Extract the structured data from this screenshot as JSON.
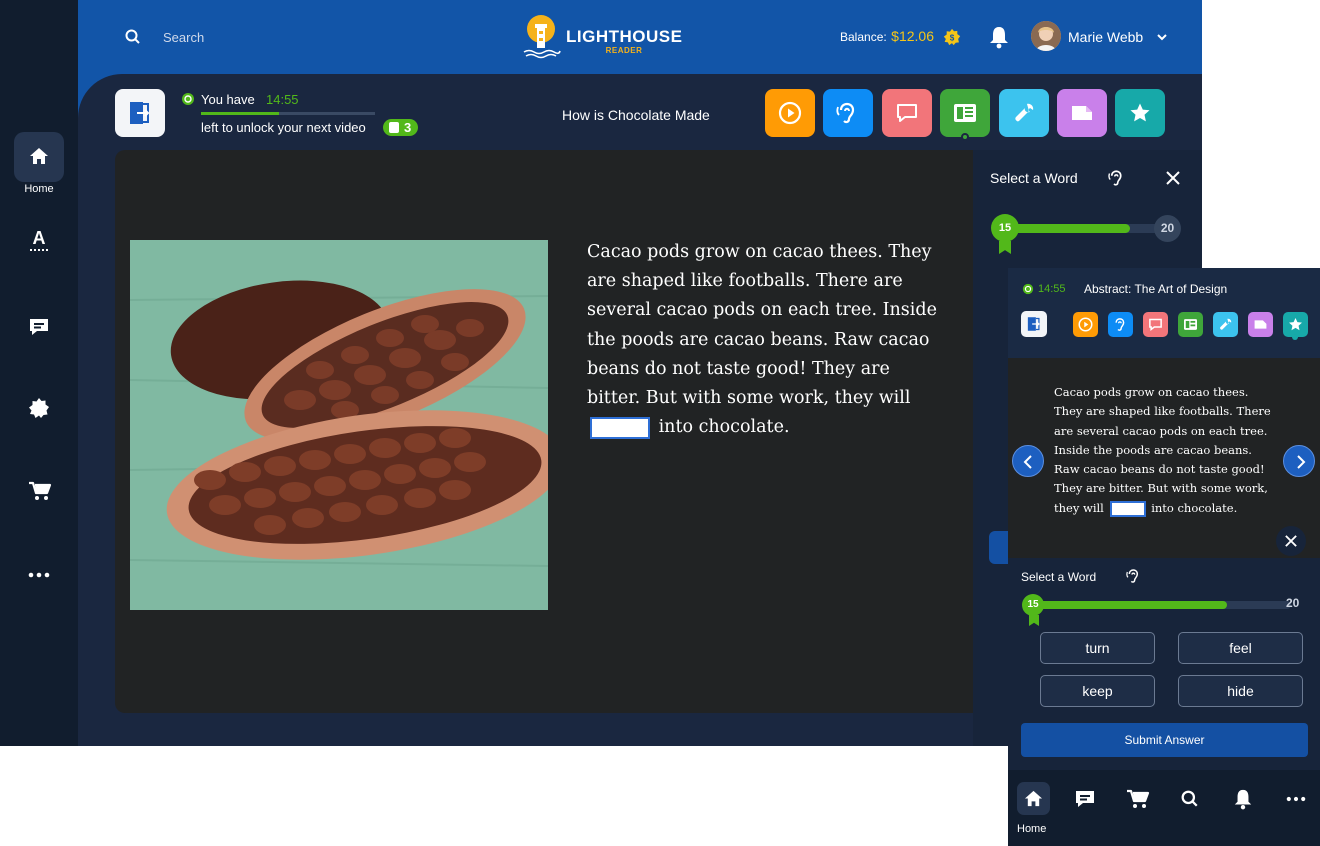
{
  "top_nav": {
    "search_placeholder": "Search",
    "brand": {
      "name": "LIGHTHOUSE",
      "sub": "READER"
    },
    "balance_label": "Balance:",
    "balance_value": "$12.06",
    "user_name": "Marie Webb"
  },
  "sidebar": {
    "home_label": "Home",
    "items": [
      "home-icon",
      "text-icon",
      "message-icon",
      "badge-icon",
      "cart-icon",
      "more-icon"
    ]
  },
  "timer": {
    "prefix": "You have",
    "time": "14:55",
    "suffix": "left to unlock your next video",
    "progress": 0.45,
    "coins": "3"
  },
  "lesson": {
    "title": "How is Chocolate Made",
    "passage_before": "Cacao pods grow on cacao thees. They are shaped like footballs. There are several cacao pods on each tree. Inside the poods are cacao beans. Raw cacao beans do not taste good! They are bitter. But with some work, they will",
    "passage_after": "into chocolate."
  },
  "toolbar": {
    "tools": [
      {
        "name": "play-icon",
        "color": "#ff9b05"
      },
      {
        "name": "listen-icon",
        "color": "#0d8cf5"
      },
      {
        "name": "chat-icon",
        "color": "#f2757a"
      },
      {
        "name": "reader-icon",
        "color": "#3fa63a"
      },
      {
        "name": "wrench-icon",
        "color": "#3cc3ee"
      },
      {
        "name": "tag-icon",
        "color": "#c980ea"
      },
      {
        "name": "star-icon",
        "color": "#17a9a9"
      }
    ]
  },
  "quiz": {
    "title": "Select a Word",
    "current": "15",
    "total": "20",
    "progress": 0.75
  },
  "mobile": {
    "time": "14:55",
    "title": "Abstract: The Art of Design",
    "passage_before": "Cacao pods grow on cacao thees. They are shaped like footballs. There are several cacao pods on each tree. Inside the poods are cacao beans. Raw cacao beans do not taste good! They are bitter. But with some work, they will",
    "passage_after": "into chocolate.",
    "quiz_title": "Select a Word",
    "quiz_current": "15",
    "quiz_total": "20",
    "options": [
      "turn",
      "feel",
      "keep",
      "hide"
    ],
    "submit_label": "Submit Answer",
    "bottom_nav": {
      "home_label": "Home"
    }
  },
  "colors": {
    "brand_blue": "#1450a3",
    "nav_blue": "#1255a8",
    "panel_dark": "#17243a",
    "reading_bg": "#212324",
    "accent_green": "#52b81a",
    "balance_yellow": "#f5c518"
  }
}
